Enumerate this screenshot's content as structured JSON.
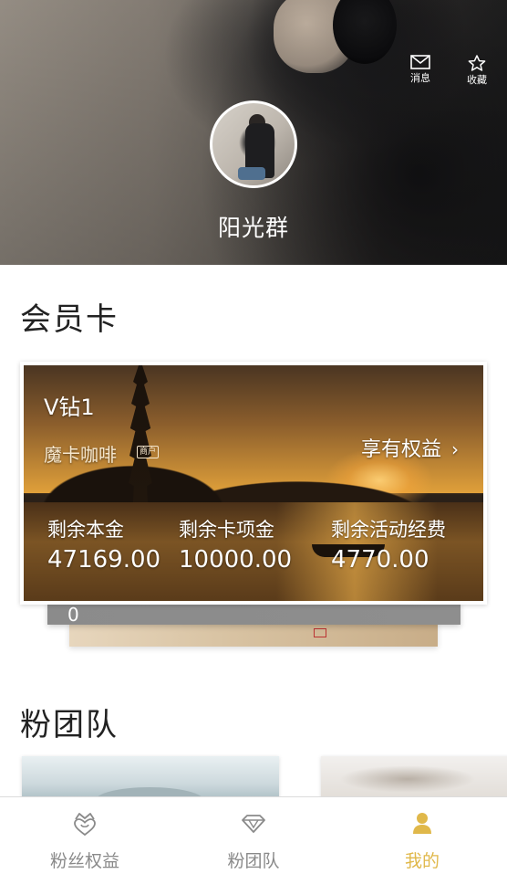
{
  "header": {
    "actions": [
      {
        "label": "消息",
        "icon": "mail-icon"
      },
      {
        "label": "收藏",
        "icon": "star-icon"
      }
    ],
    "username": "阳光群"
  },
  "member_section": {
    "title": "会员卡",
    "card": {
      "level": "V钻1",
      "shop_name": "魔卡咖啡",
      "shop_tag": "商户",
      "benefits_label": "享有权益",
      "benefits_arrow": "›",
      "stats": [
        {
          "label": "剩余本金",
          "value": "47169.00"
        },
        {
          "label": "剩余卡项金",
          "value": "10000.00"
        },
        {
          "label": "剩余活动经费",
          "value": "4770.00"
        }
      ]
    },
    "stacked_card_value": "0"
  },
  "team_section": {
    "title": "粉团队"
  },
  "tabbar": {
    "tabs": [
      {
        "label": "粉丝权益",
        "icon": "crown-heart-icon",
        "active": false
      },
      {
        "label": "粉团队",
        "icon": "diamond-icon",
        "active": false
      },
      {
        "label": "我的",
        "icon": "person-icon",
        "active": true
      }
    ],
    "active_color": "#e0b84a",
    "inactive_color": "#8a8a8a"
  }
}
